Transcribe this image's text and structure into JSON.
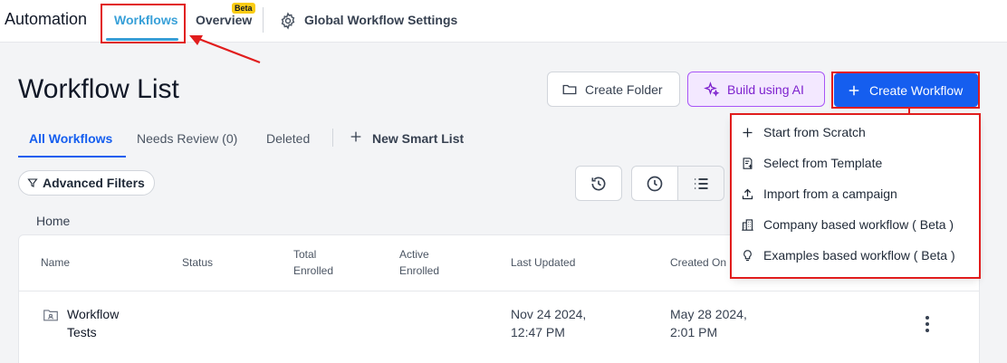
{
  "topnav": {
    "app_title": "Automation",
    "tabs": [
      {
        "label": "Workflows",
        "active": true
      },
      {
        "label": "Overview",
        "badge": "Beta"
      }
    ],
    "settings_label": "Global Workflow Settings"
  },
  "page": {
    "title": "Workflow List"
  },
  "actions": {
    "create_folder": "Create Folder",
    "build_ai": "Build using AI",
    "create_workflow": "Create Workflow"
  },
  "subtabs": {
    "all": "All Workflows",
    "needs_review": "Needs Review (0)",
    "deleted": "Deleted",
    "new_smart_list": "New Smart List"
  },
  "filters": {
    "advanced": "Advanced Filters"
  },
  "breadcrumb": "Home",
  "table": {
    "columns": [
      {
        "line1": "Name",
        "line2": ""
      },
      {
        "line1": "Status",
        "line2": ""
      },
      {
        "line1": "Total",
        "line2": "Enrolled"
      },
      {
        "line1": "Active",
        "line2": "Enrolled"
      },
      {
        "line1": "Last Updated",
        "line2": ""
      },
      {
        "line1": "Created On",
        "line2": ""
      }
    ],
    "rows": [
      {
        "name_line1": "Workflow",
        "name_line2": "Tests",
        "last_updated_line1": "Nov 24 2024,",
        "last_updated_line2": "12:47 PM",
        "created_line1": "May 28 2024,",
        "created_line2": "2:01 PM"
      }
    ]
  },
  "menu": {
    "items": [
      {
        "label": "Start from Scratch",
        "icon": "plus-icon"
      },
      {
        "label": "Select from Template",
        "icon": "template-icon"
      },
      {
        "label": "Import from a campaign",
        "icon": "upload-icon"
      },
      {
        "label": "Company based workflow ( Beta )",
        "icon": "building-icon"
      },
      {
        "label": "Examples based workflow ( Beta )",
        "icon": "lightbulb-icon"
      }
    ]
  },
  "colors": {
    "primary": "#155eef",
    "active_tab": "#38a0d8",
    "ai_accent": "#7e22ce",
    "annotation_red": "#e11d1d",
    "beta_badge": "#facc15"
  }
}
